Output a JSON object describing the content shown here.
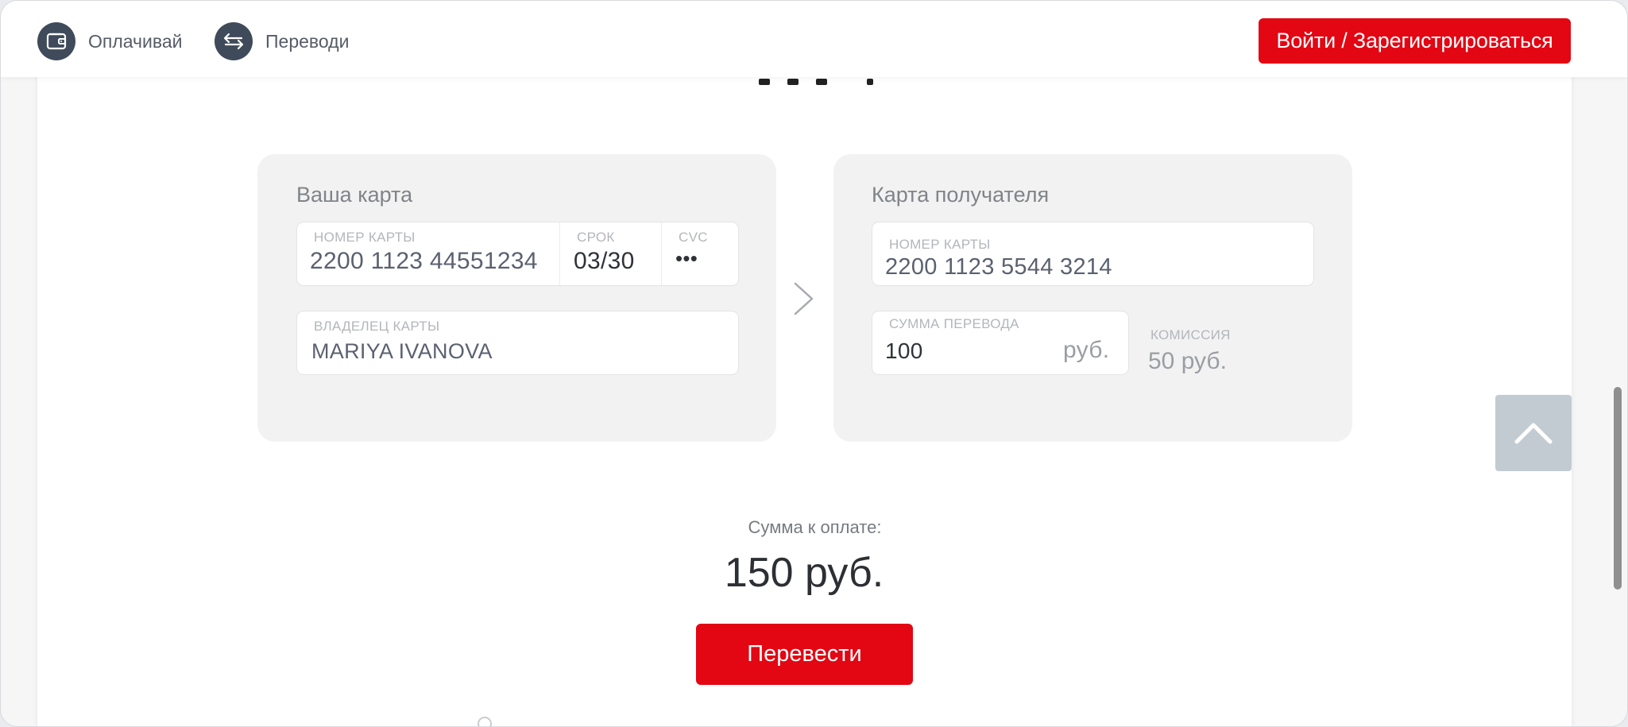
{
  "header": {
    "nav": [
      {
        "label": "Оплачивай",
        "icon": "wallet-icon"
      },
      {
        "label": "Переводи",
        "icon": "transfer-arrows-icon"
      }
    ],
    "login_label": "Войти / Зарегистрироваться"
  },
  "sender_card": {
    "title": "Ваша карта",
    "number_label": "НОМЕР КАРТЫ",
    "number_value": "2200 1123 44551234",
    "expiry_label": "СРОК",
    "expiry_value": "03/30",
    "cvc_label": "CVC",
    "cvc_value": "•••",
    "holder_label": "ВЛАДЕЛЕЦ КАРТЫ",
    "holder_value": "MARIYA IVANOVA"
  },
  "recipient_card": {
    "title": "Карта получателя",
    "number_label": "НОМЕР КАРТЫ",
    "number_value": "2200 1123 5544 3214",
    "amount_label": "СУММА ПЕРЕВОДА",
    "amount_value": "100",
    "amount_currency": "руб.",
    "commission_label": "КОМИССИЯ",
    "commission_value": "50 руб."
  },
  "total": {
    "label": "Сумма к оплате:",
    "value": "150 руб."
  },
  "transfer_button_label": "Перевести",
  "colors": {
    "accent_red": "#e30613",
    "nav_icon_bg": "#3f4a5a",
    "card_bg": "#f2f2f2",
    "scroll_top_bg": "#c3cbd2"
  }
}
